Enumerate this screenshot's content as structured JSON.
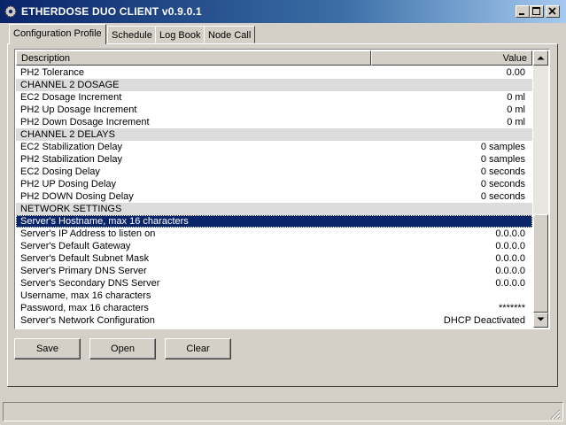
{
  "window": {
    "title": "ETHERDOSE DUO CLIENT v0.9.0.1",
    "controls": [
      "minimize",
      "maximize",
      "close"
    ]
  },
  "tabs": [
    {
      "label": "Configuration Profile",
      "active": true
    },
    {
      "label": "Schedule",
      "active": false
    },
    {
      "label": "Log Book",
      "active": false
    },
    {
      "label": "Node Call",
      "active": false
    }
  ],
  "grid": {
    "headers": {
      "description": "Description",
      "value": "Value"
    },
    "rows": [
      {
        "description": "PH2 Tolerance",
        "value": "0.00",
        "type": "item"
      },
      {
        "description": "CHANNEL 2 DOSAGE",
        "value": "",
        "type": "group"
      },
      {
        "description": "EC2 Dosage Increment",
        "value": "0 ml",
        "type": "item"
      },
      {
        "description": "PH2 Up Dosage Increment",
        "value": "0 ml",
        "type": "item"
      },
      {
        "description": "PH2 Down Dosage Increment",
        "value": "0 ml",
        "type": "item"
      },
      {
        "description": "CHANNEL 2 DELAYS",
        "value": "",
        "type": "group"
      },
      {
        "description": "EC2 Stabilization Delay",
        "value": "0 samples",
        "type": "item"
      },
      {
        "description": "PH2 Stabilization Delay",
        "value": "0 samples",
        "type": "item"
      },
      {
        "description": "EC2 Dosing Delay",
        "value": "0 seconds",
        "type": "item"
      },
      {
        "description": "PH2 UP Dosing Delay",
        "value": "0 seconds",
        "type": "item"
      },
      {
        "description": "PH2 DOWN Dosing Delay",
        "value": "0 seconds",
        "type": "item"
      },
      {
        "description": "NETWORK SETTINGS",
        "value": "",
        "type": "group"
      },
      {
        "description": "Server's Hostname, max 16 characters",
        "value": "",
        "type": "selected"
      },
      {
        "description": "Server's IP Address to listen on",
        "value": "0.0.0.0",
        "type": "item"
      },
      {
        "description": "Server's Default Gateway",
        "value": "0.0.0.0",
        "type": "item"
      },
      {
        "description": "Server's Default Subnet Mask",
        "value": "0.0.0.0",
        "type": "item"
      },
      {
        "description": "Server's Primary DNS Server",
        "value": "0.0.0.0",
        "type": "item"
      },
      {
        "description": "Server's Secondary DNS Server",
        "value": "0.0.0.0",
        "type": "item"
      },
      {
        "description": "Username, max 16 characters",
        "value": "",
        "type": "item"
      },
      {
        "description": "Password, max 16 characters",
        "value": "*******",
        "type": "item"
      },
      {
        "description": "Server's Network Configuration",
        "value": "DHCP Deactivated",
        "type": "item"
      }
    ]
  },
  "buttons": {
    "save": "Save",
    "open": "Open",
    "clear": "Clear"
  },
  "colors": {
    "titlebar": "#0a246a",
    "selection": "#0a246a",
    "group_row": "#dcdcdc",
    "face": "#d4d0c8"
  }
}
